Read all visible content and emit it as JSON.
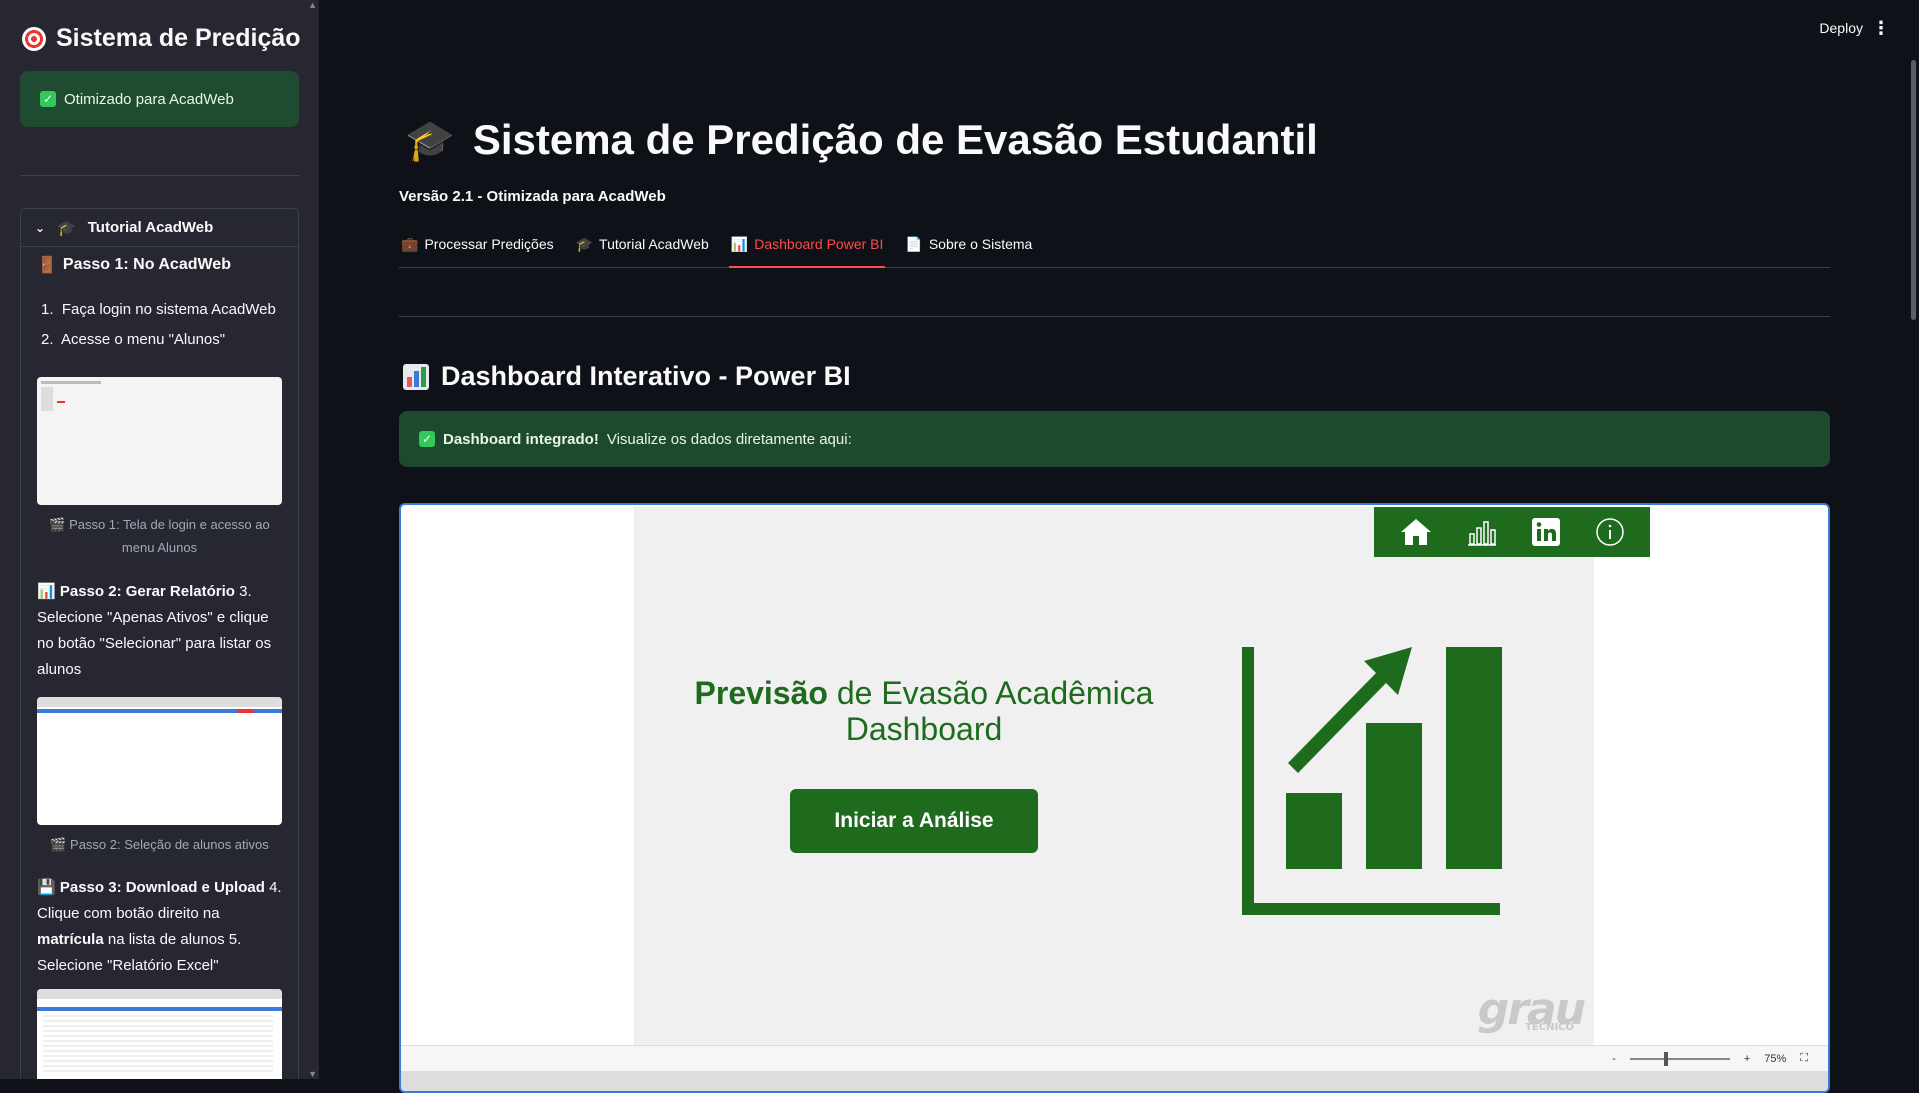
{
  "sidebar": {
    "title": "Sistema de Predição",
    "status": "Otimizado para AcadWeb",
    "expander_title": "Tutorial AcadWeb",
    "step1_title": "Passo 1: No AcadWeb",
    "step1_items": [
      "Faça login no sistema AcadWeb",
      "Acesse o menu \"Alunos\""
    ],
    "step1_caption": "Passo 1: Tela de login e acesso ao menu Alunos",
    "step2_title": "Passo 2: Gerar Relatório",
    "step2_text": "3. Selecione \"Apenas Ativos\" e clique no botão \"Selecionar\" para listar os alunos",
    "step2_caption": "Passo 2: Seleção de alunos ativos",
    "step3_title": "Passo 3: Download e Upload",
    "step3_text_a": "4. Clique com botão direito na",
    "step3_bold": "matrícula",
    "step3_text_b": "na lista de alunos 5. Selecione \"Relatório Excel\""
  },
  "header": {
    "deploy": "Deploy"
  },
  "main": {
    "title": "Sistema de Predição de Evasão Estudantil",
    "version": "Versão 2.1 - Otimizada para AcadWeb",
    "tabs": [
      {
        "label": "Processar Predições",
        "icon": "briefcase-icon"
      },
      {
        "label": "Tutorial AcadWeb",
        "icon": "graduation-cap-icon"
      },
      {
        "label": "Dashboard Power BI",
        "icon": "bar-chart-icon"
      },
      {
        "label": "Sobre o Sistema",
        "icon": "document-icon"
      }
    ],
    "active_tab": 2,
    "section_title": "Dashboard Interativo - Power BI",
    "alert_bold": "Dashboard integrado!",
    "alert_text": "Visualize os dados diretamente aqui:"
  },
  "report": {
    "title_bold": "Previsão",
    "title_rest": "de Evasão Acadêmica",
    "title_line2": "Dashboard",
    "button": "Iniciar a Análise",
    "logo": "grau",
    "logo_sub": "TÉCNICO",
    "zoom": "75%",
    "zoom_minus": "-",
    "zoom_plus": "+"
  },
  "colors": {
    "accent_red": "#ff4b4b",
    "report_green": "#1e6b1e",
    "success_bg": "#1d4a2d"
  }
}
